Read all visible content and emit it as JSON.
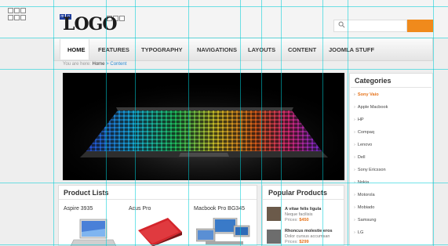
{
  "logo": {
    "text": "LOGO"
  },
  "nav": {
    "items": [
      {
        "label": "HOME",
        "active": true
      },
      {
        "label": "FEATURES"
      },
      {
        "label": "TYPOGRAPHY"
      },
      {
        "label": "NAVIGATIONS"
      },
      {
        "label": "LAYOUTS"
      },
      {
        "label": "CONTENT"
      },
      {
        "label": "JOOMLA STUFF"
      }
    ]
  },
  "search": {
    "button_color": "#f08a1c"
  },
  "breadcrumb": {
    "prefix": "You are here:",
    "home": "Home",
    "separator": ">",
    "current": "Content"
  },
  "categories": {
    "title": "Categories",
    "items": [
      {
        "label": "Sony Vaio",
        "active": true
      },
      {
        "label": "Apple Macbook"
      },
      {
        "label": "HP"
      },
      {
        "label": "Compaq"
      },
      {
        "label": "Lenovo"
      },
      {
        "label": "Dell"
      },
      {
        "label": "Sony Ericsson"
      },
      {
        "label": "Nokia"
      },
      {
        "label": "Motorola"
      },
      {
        "label": "Mobiado"
      },
      {
        "label": "Samsung"
      },
      {
        "label": "LG"
      }
    ]
  },
  "product_lists": {
    "title": "Product Lists",
    "items": [
      {
        "name": "Aspire 3935"
      },
      {
        "name": "Acus Pro"
      },
      {
        "name": "Macbook  Pro BG345"
      }
    ]
  },
  "popular_products": {
    "title": "Popular Products",
    "items": [
      {
        "name": "A vitae felis ligula",
        "desc": "Neque facilisis",
        "price_label": "Prices:",
        "price": "$450"
      },
      {
        "name": "Rhoncus molestie eros",
        "desc": "Dolor cursus accumsan",
        "price_label": "Prices:",
        "price": "$299"
      }
    ]
  },
  "colors": {
    "accent": "#f08a1c",
    "link": "#2a8bd4",
    "guide": "#00cdd7"
  }
}
